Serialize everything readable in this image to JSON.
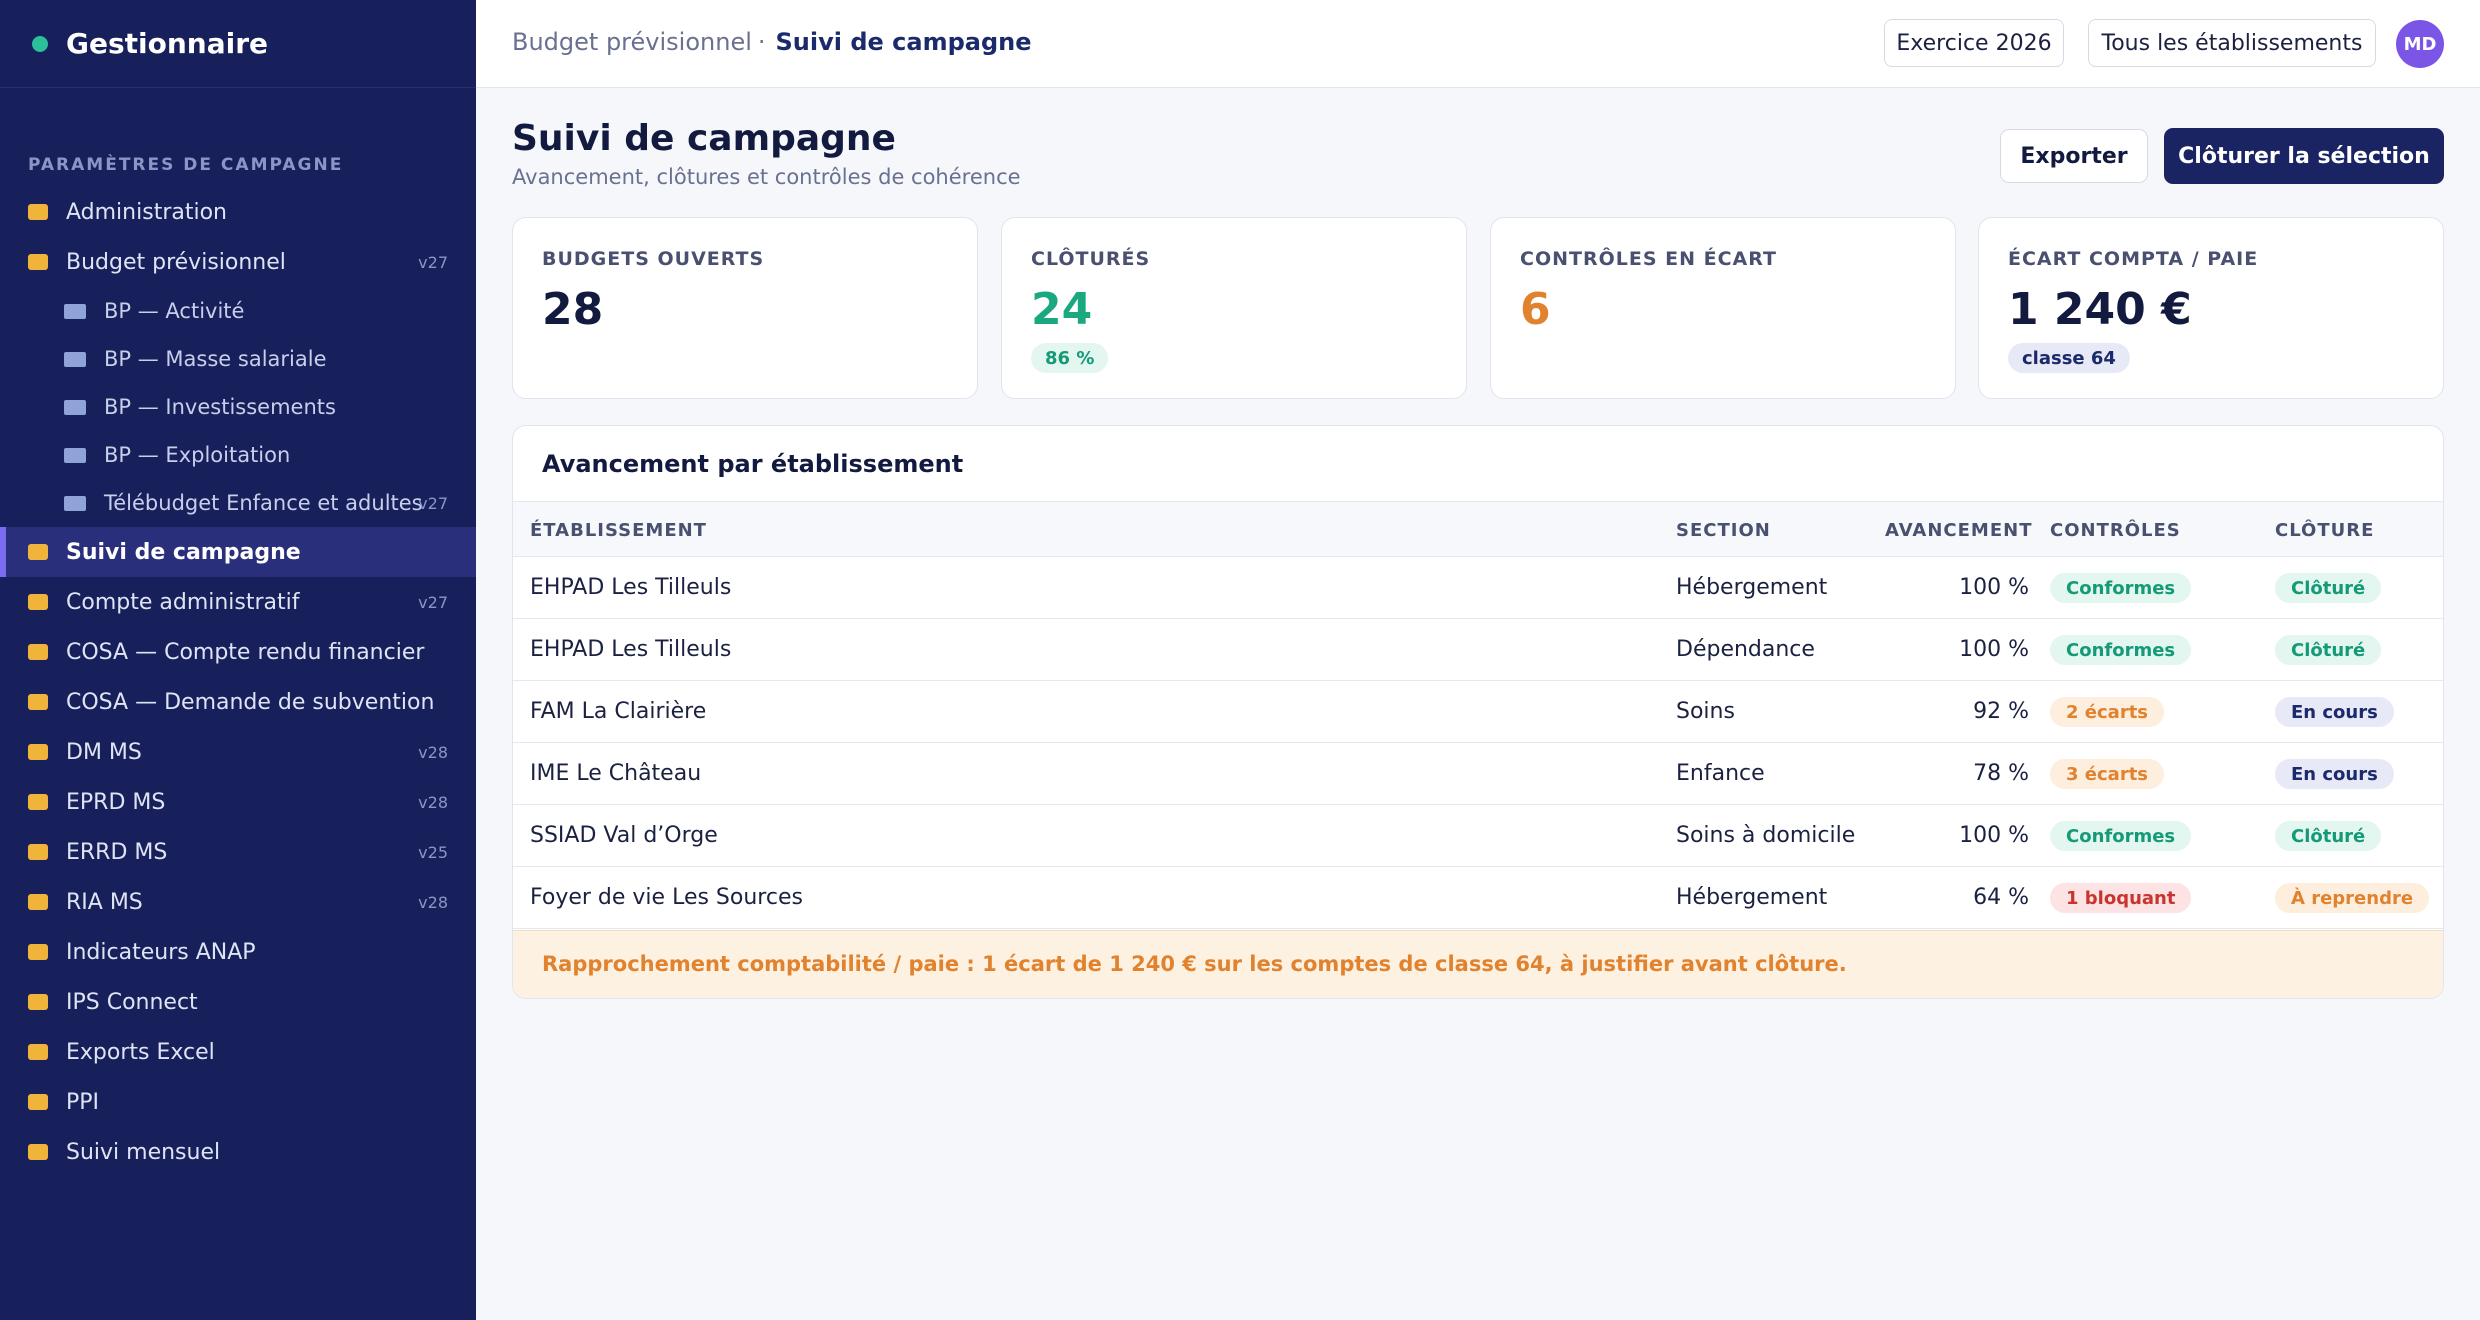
{
  "brand": {
    "name": "Gestionnaire",
    "status_color": "#2bbf9a"
  },
  "sidebar": {
    "section_title": "PARAMÈTRES DE CAMPAGNE",
    "items": [
      {
        "label": "Administration",
        "version": ""
      },
      {
        "label": "Budget prévisionnel",
        "version": "v27"
      },
      {
        "label": "BP — Activité",
        "version": "",
        "sub": true
      },
      {
        "label": "BP — Masse salariale",
        "version": "",
        "sub": true
      },
      {
        "label": "BP — Investissements",
        "version": "",
        "sub": true
      },
      {
        "label": "BP — Exploitation",
        "version": "",
        "sub": true
      },
      {
        "label": "Télébudget Enfance et adultes",
        "version": "v27",
        "sub": true
      },
      {
        "label": "Suivi de campagne",
        "version": "",
        "active": true
      },
      {
        "label": "Compte administratif",
        "version": "v27"
      },
      {
        "label": "COSA — Compte rendu financier",
        "version": ""
      },
      {
        "label": "COSA — Demande de subvention",
        "version": ""
      },
      {
        "label": "DM MS",
        "version": "v28"
      },
      {
        "label": "EPRD MS",
        "version": "v28"
      },
      {
        "label": "ERRD MS",
        "version": "v25"
      },
      {
        "label": "RIA MS",
        "version": "v28"
      },
      {
        "label": "Indicateurs ANAP",
        "version": ""
      },
      {
        "label": "IPS Connect",
        "version": ""
      },
      {
        "label": "Exports Excel",
        "version": ""
      },
      {
        "label": "PPI",
        "version": ""
      },
      {
        "label": "Suivi mensuel",
        "version": ""
      }
    ]
  },
  "topbar": {
    "breadcrumb_parent": "Budget prévisionnel",
    "breadcrumb_sep": "·",
    "breadcrumb_current": "Suivi de campagne",
    "exercise_label": "Exercice 2026",
    "scope_label": "Tous les établissements",
    "avatar_initials": "MD"
  },
  "header": {
    "title": "Suivi de campagne",
    "subtitle": "Avancement, clôtures et contrôles de cohérence",
    "export_label": "Exporter",
    "close_label": "Clôturer la sélection"
  },
  "kpis": [
    {
      "label": "BUDGETS OUVERTS",
      "value": "28",
      "badge": "",
      "value_color": "#131a3f"
    },
    {
      "label": "CLÔTURÉS",
      "value": "24",
      "badge": "86 %",
      "value_color": "#19a880"
    },
    {
      "label": "CONTRÔLES EN ÉCART",
      "value": "6",
      "badge": "",
      "value_color": "#e0822e"
    },
    {
      "label": "ÉCART COMPTA / PAIE",
      "value": "1 240 €",
      "badge": "classe 64",
      "value_color": "#131a3f"
    }
  ],
  "table": {
    "title": "Avancement par établissement",
    "columns": [
      "ÉTABLISSEMENT",
      "SECTION",
      "AVANCEMENT",
      "CONTRÔLES",
      "CLÔTURE"
    ],
    "rows": [
      {
        "etablissement": "EHPAD Les Tilleuls",
        "section": "Hébergement",
        "avancement": "100 %",
        "controles": "Conformes",
        "controles_status": "ok",
        "cloture": "Clôturé",
        "cloture_status": "ok"
      },
      {
        "etablissement": "EHPAD Les Tilleuls",
        "section": "Dépendance",
        "avancement": "100 %",
        "controles": "Conformes",
        "controles_status": "ok",
        "cloture": "Clôturé",
        "cloture_status": "ok"
      },
      {
        "etablissement": "FAM La Clairière",
        "section": "Soins",
        "avancement": "92 %",
        "controles": "2 écarts",
        "controles_status": "warn",
        "cloture": "En cours",
        "cloture_status": "prog"
      },
      {
        "etablissement": "IME Le Château",
        "section": "Enfance",
        "avancement": "78 %",
        "controles": "3 écarts",
        "controles_status": "warn",
        "cloture": "En cours",
        "cloture_status": "prog"
      },
      {
        "etablissement": "SSIAD Val d’Orge",
        "section": "Soins à domicile",
        "avancement": "100 %",
        "controles": "Conformes",
        "controles_status": "ok",
        "cloture": "Clôturé",
        "cloture_status": "ok"
      },
      {
        "etablissement": "Foyer de vie Les Sources",
        "section": "Hébergement",
        "avancement": "64 %",
        "controles": "1 bloquant",
        "controles_status": "bad",
        "cloture": "À reprendre",
        "cloture_status": "redo"
      }
    ],
    "footer_note": "Rapprochement comptabilité / paie : 1 écart de 1 240 € sur les comptes de classe 64, à justifier avant clôture."
  }
}
